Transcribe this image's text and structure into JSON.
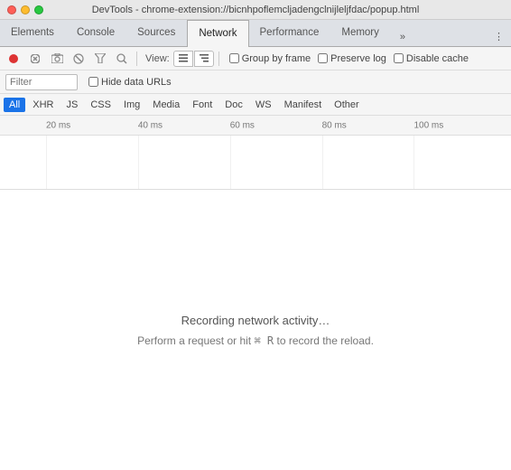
{
  "titleBar": {
    "title": "DevTools - chrome-extension://bicnhpoflemcljadengclnijleljfdac/popup.html"
  },
  "tabs": [
    {
      "label": "Elements",
      "active": false
    },
    {
      "label": "Console",
      "active": false
    },
    {
      "label": "Sources",
      "active": false
    },
    {
      "label": "Network",
      "active": true
    },
    {
      "label": "Performance",
      "active": false
    },
    {
      "label": "Memory",
      "active": false
    }
  ],
  "moreTabsIcon": "»",
  "settingsIcon": "⋮",
  "toolbar1": {
    "viewLabel": "View:",
    "groupByFrame": "Group by frame",
    "preserveLog": "Preserve log",
    "disableCache": "Disable cache"
  },
  "toolbar2": {
    "filterPlaceholder": "Filter",
    "hideDataURLs": "Hide data URLs"
  },
  "filterTabs": [
    {
      "label": "All",
      "active": true
    },
    {
      "label": "XHR"
    },
    {
      "label": "JS"
    },
    {
      "label": "CSS"
    },
    {
      "label": "Img"
    },
    {
      "label": "Media"
    },
    {
      "label": "Font"
    },
    {
      "label": "Doc"
    },
    {
      "label": "WS"
    },
    {
      "label": "Manifest"
    },
    {
      "label": "Other"
    }
  ],
  "timelineMarkers": [
    {
      "label": "20 ms",
      "percent": 9
    },
    {
      "label": "40 ms",
      "percent": 27
    },
    {
      "label": "60 ms",
      "percent": 45
    },
    {
      "label": "80 ms",
      "percent": 63
    },
    {
      "label": "100 ms",
      "percent": 81
    }
  ],
  "mainContent": {
    "recordingText": "Recording network activity…",
    "hintText": "Perform a request or hit",
    "cmdR": "⌘ R",
    "hintSuffix": " to record the reload."
  }
}
